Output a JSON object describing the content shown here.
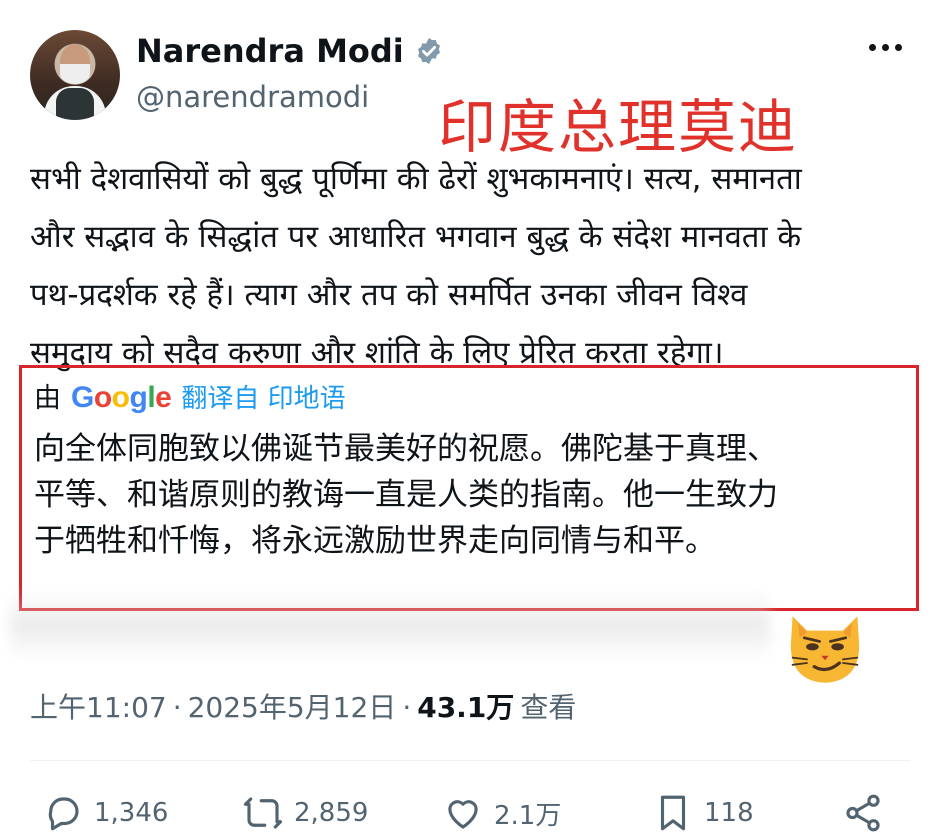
{
  "author": {
    "display_name": "Narendra Modi",
    "handle": "@narendramodi",
    "verified": true
  },
  "overlay_caption": "印度总理莫迪",
  "tweet": {
    "hindi_lines": [
      "सभी देशवासियों को बुद्ध पूर्णिमा की ढेरों शुभकामनाएं। सत्य, समानता",
      "और सद्भाव के सिद्धांत पर आधारित भगवान बुद्ध के संदेश मानवता के",
      "पथ-प्रदर्शक रहे हैं। त्याग और तप को समर्पित उनका जीवन विश्व",
      "समुदाय को सदैव करुणा और शांति के लिए प्रेरित करता रहेगा।"
    ]
  },
  "translation": {
    "by_label": "由",
    "provider": "Google",
    "source_label": "翻译自 印地语",
    "lines": [
      "向全体同胞致以佛诞节最美好的祝愿。佛陀基于真理、",
      "平等、和谐原则的教诲一直是人类的指南。他一生致力",
      "于牺牲和忏悔，将永远激励世界走向同情与和平。"
    ]
  },
  "meta": {
    "time": "上午11:07",
    "date": "2025年5月12日",
    "views": "43.1万",
    "views_label": "查看"
  },
  "actions": {
    "replies": "1,346",
    "reposts": "2,859",
    "likes": "2.1万",
    "bookmarks": "118"
  },
  "colors": {
    "overlay_red": "#e0312b",
    "box_border": "#d7262b",
    "link_blue": "#1d9bf0",
    "muted": "#536471"
  }
}
